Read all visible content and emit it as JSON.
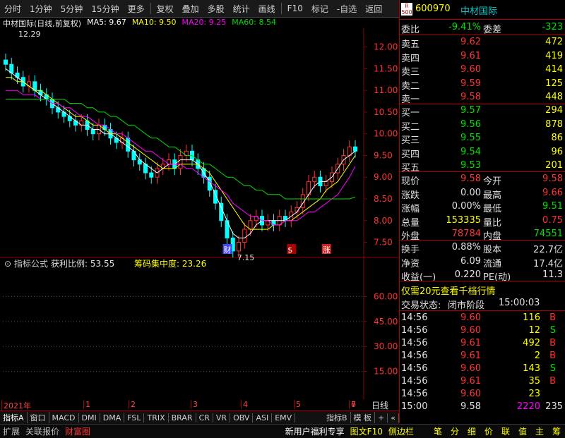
{
  "toolbar": {
    "items": [
      "分时",
      "1分钟",
      "5分钟",
      "15分钟",
      "更多",
      "复权",
      "叠加",
      "多股",
      "统计",
      "画线",
      "F10",
      "标记",
      "-自选",
      "返回"
    ]
  },
  "title": {
    "name": "中材国际(日线,前复权)",
    "ma5": "MA5: 9.67",
    "ma10": "MA10: 9.50",
    "ma20": "MA20: 9.25",
    "ma60": "MA60: 8.54"
  },
  "colors": {
    "up": "#ff3333",
    "down": "#00ffff",
    "ma5": "#ffffff",
    "ma10": "#ffff00",
    "ma20": "#ff00ff",
    "ma60": "#00dd00",
    "grid": "#8b0000"
  },
  "chart_data": {
    "type": "candlestick",
    "ylim": [
      7.2,
      12.4
    ],
    "yticks": [
      "12.00",
      "11.50",
      "11.00",
      "10.50",
      "10.00",
      "9.50",
      "9.00",
      "8.50",
      "8.00",
      "7.50"
    ],
    "ytick_values": [
      12.0,
      11.5,
      11.0,
      10.5,
      10.0,
      9.5,
      9.0,
      8.5,
      8.0,
      7.5
    ],
    "high_label": "12.29",
    "low_label": "7.15",
    "xlabels": [
      "2021年",
      "1",
      "2",
      "3",
      "4",
      "5",
      "6",
      "7"
    ],
    "markers": [
      "财",
      "$",
      "涨"
    ],
    "close": [
      11.6,
      11.4,
      11.3,
      11.1,
      11.2,
      11.0,
      10.9,
      10.8,
      10.6,
      10.5,
      10.4,
      10.3,
      10.2,
      10.3,
      10.1,
      10.0,
      10.2,
      10.1,
      9.9,
      9.8,
      9.9,
      9.6,
      9.4,
      9.3,
      9.1,
      9.0,
      9.2,
      9.3,
      9.4,
      9.2,
      9.5,
      9.6,
      9.4,
      9.2,
      9.0,
      8.7,
      8.4,
      8.0,
      7.6,
      7.3,
      7.5,
      7.8,
      8.0,
      8.1,
      7.9,
      8.0,
      7.9,
      8.1,
      8.0,
      8.2,
      8.3,
      8.6,
      8.9,
      9.0,
      8.8,
      8.9,
      9.1,
      9.3,
      9.5,
      9.7,
      9.6
    ],
    "ma5": [
      11.5,
      11.4,
      11.3,
      11.2,
      11.1,
      11.0,
      10.9,
      10.8,
      10.7,
      10.6,
      10.5,
      10.4,
      10.3,
      10.2,
      10.2,
      10.1,
      10.1,
      10.0,
      10.0,
      9.9,
      9.8,
      9.7,
      9.6,
      9.4,
      9.3,
      9.2,
      9.1,
      9.2,
      9.3,
      9.3,
      9.4,
      9.4,
      9.4,
      9.3,
      9.1,
      8.9,
      8.6,
      8.3,
      8.0,
      7.7,
      7.6,
      7.6,
      7.7,
      7.9,
      8.0,
      8.0,
      8.0,
      8.0,
      8.0,
      8.1,
      8.2,
      8.4,
      8.6,
      8.8,
      8.9,
      8.9,
      9.0,
      9.2,
      9.4,
      9.5,
      9.6
    ],
    "ma10": [
      11.3,
      11.3,
      11.2,
      11.2,
      11.1,
      11.0,
      11.0,
      10.9,
      10.8,
      10.7,
      10.6,
      10.5,
      10.4,
      10.4,
      10.3,
      10.2,
      10.2,
      10.1,
      10.0,
      10.0,
      9.9,
      9.8,
      9.7,
      9.6,
      9.5,
      9.4,
      9.3,
      9.2,
      9.2,
      9.2,
      9.3,
      9.3,
      9.3,
      9.3,
      9.2,
      9.1,
      8.9,
      8.7,
      8.5,
      8.3,
      8.1,
      7.9,
      7.8,
      7.8,
      7.8,
      7.8,
      7.9,
      7.9,
      8.0,
      8.0,
      8.1,
      8.2,
      8.3,
      8.4,
      8.5,
      8.7,
      8.8,
      8.9,
      9.1,
      9.3,
      9.5
    ],
    "ma20": [
      11.0,
      11.0,
      11.0,
      10.9,
      10.9,
      10.9,
      10.8,
      10.8,
      10.7,
      10.7,
      10.6,
      10.6,
      10.5,
      10.4,
      10.4,
      10.3,
      10.2,
      10.2,
      10.1,
      10.0,
      10.0,
      9.9,
      9.8,
      9.7,
      9.6,
      9.6,
      9.5,
      9.4,
      9.3,
      9.3,
      9.3,
      9.2,
      9.2,
      9.1,
      9.0,
      8.9,
      8.8,
      8.7,
      8.6,
      8.4,
      8.3,
      8.2,
      8.1,
      8.1,
      8.0,
      8.0,
      7.9,
      7.9,
      8.0,
      8.0,
      8.0,
      8.1,
      8.2,
      8.2,
      8.3,
      8.4,
      8.5,
      8.6,
      8.8,
      9.0,
      9.25
    ],
    "ma60": [
      10.8,
      10.8,
      10.8,
      10.8,
      10.8,
      10.8,
      10.8,
      10.8,
      10.8,
      10.8,
      10.8,
      10.7,
      10.7,
      10.7,
      10.6,
      10.6,
      10.5,
      10.5,
      10.4,
      10.4,
      10.3,
      10.2,
      10.2,
      10.1,
      10.0,
      9.9,
      9.9,
      9.8,
      9.7,
      9.7,
      9.6,
      9.5,
      9.5,
      9.4,
      9.3,
      9.3,
      9.2,
      9.1,
      9.0,
      9.0,
      8.9,
      8.8,
      8.8,
      8.7,
      8.7,
      8.6,
      8.6,
      8.6,
      8.5,
      8.5,
      8.5,
      8.5,
      8.5,
      8.5,
      8.5,
      8.5,
      8.5,
      8.5,
      8.5,
      8.5,
      8.54
    ]
  },
  "indicator": {
    "title": "指标公式",
    "label1": "获利比例: 53.55",
    "label2": "筹码集中度: 23.26",
    "yticks": [
      "60.00",
      "45.00",
      "30.00",
      "15.00"
    ],
    "ytick_values": [
      60,
      45,
      30,
      15
    ]
  },
  "quote": {
    "badge_r": "R",
    "badge_n": "500",
    "code": "600970",
    "name": "中材国际",
    "weibi_label": "委比",
    "weibi": "-9.41%",
    "weicha_label": "委差",
    "weicha": "-323",
    "sells": [
      {
        "l": "卖五",
        "p": "9.62",
        "v": "472"
      },
      {
        "l": "卖四",
        "p": "9.61",
        "v": "419"
      },
      {
        "l": "卖三",
        "p": "9.60",
        "v": "414"
      },
      {
        "l": "卖二",
        "p": "9.59",
        "v": "125"
      },
      {
        "l": "卖一",
        "p": "9.58",
        "v": "448"
      }
    ],
    "buys": [
      {
        "l": "买一",
        "p": "9.57",
        "v": "294"
      },
      {
        "l": "买二",
        "p": "9.56",
        "v": "878"
      },
      {
        "l": "买三",
        "p": "9.55",
        "v": "86"
      },
      {
        "l": "买四",
        "p": "9.54",
        "v": "96"
      },
      {
        "l": "买五",
        "p": "9.53",
        "v": "201"
      }
    ],
    "stats": [
      {
        "l1": "现价",
        "v1": "9.58",
        "l2": "今开",
        "v2": "9.58"
      },
      {
        "l1": "涨跌",
        "v1": "0.00",
        "l2": "最高",
        "v2": "9.66"
      },
      {
        "l1": "涨幅",
        "v1": "0.00%",
        "l2": "最低",
        "v2": "9.51"
      },
      {
        "l1": "总量",
        "v1": "153335",
        "l2": "量比",
        "v2": "0.75"
      },
      {
        "l1": "外盘",
        "v1": "78784",
        "l2": "内盘",
        "v2": "74551"
      }
    ],
    "stats2": [
      {
        "l1": "换手",
        "v1": "0.88%",
        "l2": "股本",
        "v2": "22.7亿"
      },
      {
        "l1": "净资",
        "v1": "6.09",
        "l2": "流通",
        "v2": "17.4亿"
      },
      {
        "l1": "收益(一)",
        "v1": "0.220",
        "l2": "PE(动)",
        "v2": "11.3"
      }
    ],
    "promo": "仅需20元查看千档行情",
    "status_label": "交易状态:",
    "status_value": "闭市阶段",
    "status_time": "15:00:03",
    "ticks": [
      {
        "t": "14:56",
        "p": "9.60",
        "v": "116",
        "d": "B"
      },
      {
        "t": "14:56",
        "p": "9.60",
        "v": "12",
        "d": "S"
      },
      {
        "t": "14:56",
        "p": "9.61",
        "v": "492",
        "d": "B"
      },
      {
        "t": "14:56",
        "p": "9.61",
        "v": "2",
        "d": "B"
      },
      {
        "t": "14:56",
        "p": "9.60",
        "v": "143",
        "d": "S"
      },
      {
        "t": "14:56",
        "p": "9.61",
        "v": "35",
        "d": "B"
      },
      {
        "t": "14:56",
        "p": "9.60",
        "v": "23",
        "d": ""
      },
      {
        "t": "15:00",
        "p": "9.58",
        "v": "2220",
        "d": "235"
      }
    ]
  },
  "tabs1": [
    "指标A",
    "窗口",
    "MACD",
    "DMI",
    "DMA",
    "FSL",
    "TRIX",
    "BRAR",
    "CR",
    "VR",
    "OBV",
    "ASI",
    "EMV",
    "指标B",
    "模 板",
    "+",
    "«"
  ],
  "rightTab": "日线",
  "tabs2": [
    "扩展",
    "关联报价",
    "财富圈",
    "新用户福利专享",
    "图文F10",
    "侧边栏",
    "笔",
    "分",
    "细",
    "价",
    "联",
    "值",
    "主",
    "筹"
  ]
}
